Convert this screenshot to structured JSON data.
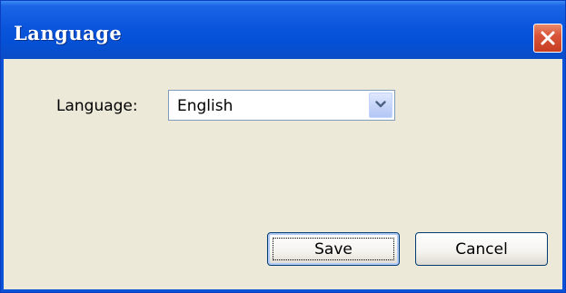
{
  "window": {
    "title": "Language"
  },
  "form": {
    "language_label": "Language:",
    "language_selected": "English"
  },
  "buttons": {
    "save_label": "Save",
    "cancel_label": "Cancel"
  },
  "icons": {
    "close": "close-icon",
    "dropdown": "chevron-down-icon"
  },
  "colors": {
    "titlebar": "#0a55dc",
    "close_button": "#d9553a",
    "dialog_background": "#ece9d8"
  }
}
